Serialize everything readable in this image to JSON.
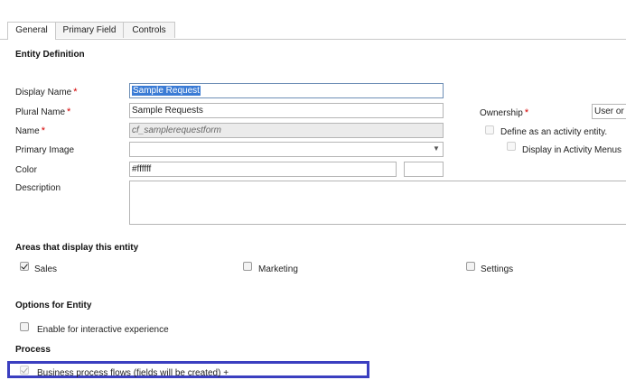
{
  "tabs": [
    {
      "label": "General",
      "active": true
    },
    {
      "label": "Primary Field",
      "active": false
    },
    {
      "label": "Controls",
      "active": false
    }
  ],
  "entity_definition": {
    "title": "Entity Definition",
    "display_name": {
      "label": "Display Name",
      "value": "Sample Request"
    },
    "plural_name": {
      "label": "Plural Name",
      "value": "Sample Requests"
    },
    "name": {
      "label": "Name",
      "value": "cf_samplerequestform"
    },
    "primary_image": {
      "label": "Primary Image",
      "value": ""
    },
    "color": {
      "label": "Color",
      "value": "#ffffff"
    },
    "description": {
      "label": "Description",
      "value": ""
    },
    "ownership": {
      "label": "Ownership",
      "value": "User or"
    },
    "activity_entity": {
      "label": "Define as an activity entity.",
      "checked": false
    },
    "activity_menus": {
      "label": "Display in Activity Menus",
      "checked": false
    }
  },
  "areas": {
    "title": "Areas that display this entity",
    "items": [
      {
        "label": "Sales",
        "checked": true
      },
      {
        "label": "Marketing",
        "checked": false
      },
      {
        "label": "Settings",
        "checked": false
      }
    ]
  },
  "options": {
    "title": "Options for Entity",
    "interactive": {
      "label": "Enable for interactive experience",
      "checked": false
    }
  },
  "process": {
    "title": "Process",
    "bpf": {
      "label": "Business process flows (fields will be created)",
      "suffix": "+",
      "checked": true
    }
  },
  "required_marker": "*",
  "colors": {
    "required": "#d40000",
    "highlight": "#3b3fc0",
    "selection": "#3a7bd5"
  }
}
